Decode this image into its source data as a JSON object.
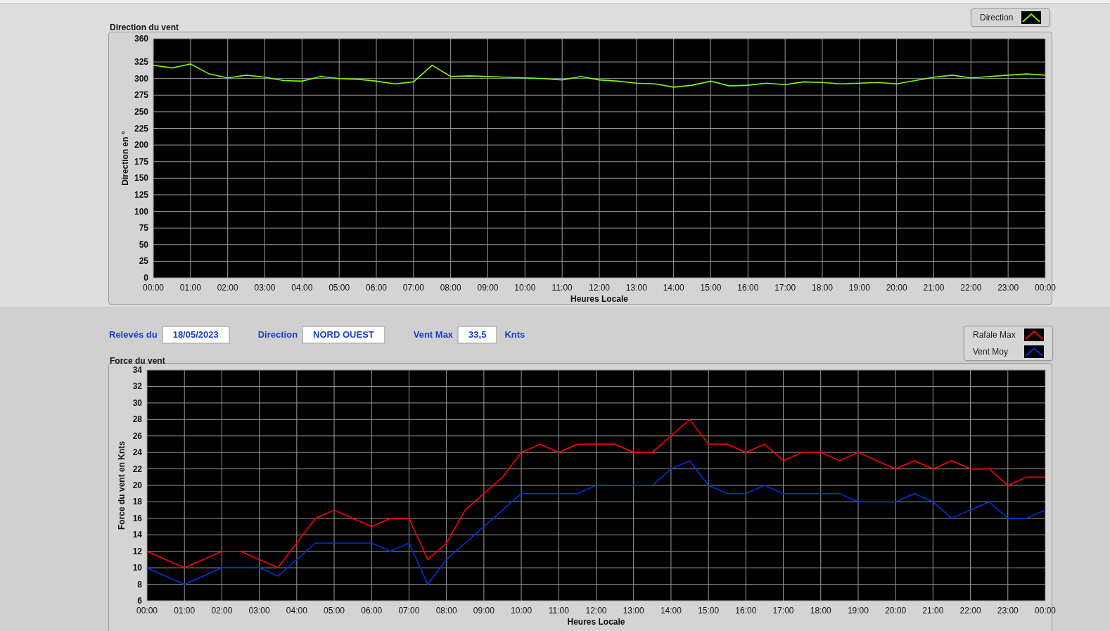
{
  "top_chart": {
    "chart_data": {
      "type": "line",
      "grid": true,
      "title": "Direction du vent",
      "xlabel": "Heures Locale",
      "ylabel": "Direction en °",
      "xlim": [
        0,
        24
      ],
      "ylim": [
        0,
        360
      ],
      "x": [
        0,
        0.5,
        1,
        1.5,
        2,
        2.5,
        3,
        3.5,
        4,
        4.5,
        5,
        5.5,
        6,
        6.5,
        7,
        7.5,
        8,
        8.5,
        9,
        9.5,
        10,
        10.5,
        11,
        11.5,
        12,
        12.5,
        13,
        13.5,
        14,
        14.5,
        15,
        15.5,
        16,
        16.5,
        17,
        17.5,
        18,
        18.5,
        19,
        19.5,
        20,
        20.5,
        21,
        21.5,
        22,
        22.5,
        23,
        23.5,
        24
      ],
      "series": [
        {
          "name": "Direction",
          "color": "#7cfc00",
          "values": [
            320,
            316,
            322,
            307,
            301,
            305,
            302,
            297,
            296,
            303,
            300,
            299,
            296,
            292,
            295,
            320,
            303,
            304,
            303,
            302,
            301,
            300,
            298,
            303,
            298,
            296,
            293,
            292,
            287,
            290,
            296,
            289,
            290,
            293,
            291,
            295,
            294,
            292,
            293,
            294,
            292,
            297,
            302,
            305,
            301,
            303,
            305,
            307,
            305
          ]
        }
      ],
      "xticks": [
        {
          "value": 0,
          "label": "00:00"
        },
        {
          "value": 1,
          "label": "01:00"
        },
        {
          "value": 2,
          "label": "02:00"
        },
        {
          "value": 3,
          "label": "03:00"
        },
        {
          "value": 4,
          "label": "04:00"
        },
        {
          "value": 5,
          "label": "05:00"
        },
        {
          "value": 6,
          "label": "06:00"
        },
        {
          "value": 7,
          "label": "07:00"
        },
        {
          "value": 8,
          "label": "08:00"
        },
        {
          "value": 9,
          "label": "09:00"
        },
        {
          "value": 10,
          "label": "10:00"
        },
        {
          "value": 11,
          "label": "11:00"
        },
        {
          "value": 12,
          "label": "12:00"
        },
        {
          "value": 13,
          "label": "13:00"
        },
        {
          "value": 14,
          "label": "14:00"
        },
        {
          "value": 15,
          "label": "15:00"
        },
        {
          "value": 16,
          "label": "16:00"
        },
        {
          "value": 17,
          "label": "17:00"
        },
        {
          "value": 18,
          "label": "18:00"
        },
        {
          "value": 19,
          "label": "19:00"
        },
        {
          "value": 20,
          "label": "20:00"
        },
        {
          "value": 21,
          "label": "21:00"
        },
        {
          "value": 22,
          "label": "22:00"
        },
        {
          "value": 23,
          "label": "23:00"
        },
        {
          "value": 24,
          "label": "00:00"
        }
      ],
      "yticks": [
        0,
        25,
        50,
        75,
        100,
        125,
        150,
        175,
        200,
        225,
        250,
        275,
        300,
        325,
        360
      ]
    }
  },
  "readings": [
    {
      "label": "Relevés du",
      "value": "18/05/2023"
    },
    {
      "label": "Direction",
      "value": "NORD OUEST"
    },
    {
      "label": "Vent Max",
      "value": "33,5",
      "unit": "Knts"
    }
  ],
  "bottom_chart": {
    "chart_data": {
      "type": "line",
      "grid": true,
      "title": "Force du vent",
      "xlabel": "Heures Locale",
      "ylabel": "Force du vent en Knts",
      "xlim": [
        0,
        24
      ],
      "ylim": [
        6,
        34
      ],
      "x": [
        0,
        0.5,
        1,
        1.5,
        2,
        2.5,
        3,
        3.5,
        4,
        4.5,
        5,
        5.5,
        6,
        6.5,
        7,
        7.5,
        8,
        8.5,
        9,
        9.5,
        10,
        10.5,
        11,
        11.5,
        12,
        12.5,
        13,
        13.5,
        14,
        14.5,
        15,
        15.5,
        16,
        16.5,
        17,
        17.5,
        18,
        18.5,
        19,
        19.5,
        20,
        20.5,
        21,
        21.5,
        22,
        22.5,
        23,
        23.5,
        24
      ],
      "series": [
        {
          "name": "Rafale Max",
          "color": "#ff0000",
          "values": [
            12,
            11,
            10,
            11,
            12,
            12,
            11,
            10,
            13,
            16,
            17,
            16,
            15,
            16,
            16,
            11,
            13,
            17,
            19,
            21,
            24,
            25,
            24,
            25,
            25,
            25,
            24,
            24,
            26,
            28,
            25,
            25,
            24,
            25,
            23,
            24,
            24,
            23,
            24,
            23,
            22,
            23,
            22,
            23,
            22,
            22,
            20,
            21,
            21
          ]
        },
        {
          "name": "Vent Moy",
          "color": "#0033dd",
          "values": [
            10,
            9,
            8,
            9,
            10,
            10,
            10,
            9,
            11,
            13,
            13,
            13,
            13,
            12,
            13,
            8,
            11,
            13,
            15,
            17,
            19,
            19,
            19,
            19,
            20,
            20,
            20,
            20,
            22,
            23,
            20,
            19,
            19,
            20,
            19,
            19,
            19,
            19,
            18,
            18,
            18,
            19,
            18,
            16,
            17,
            18,
            16,
            16,
            17
          ]
        }
      ],
      "xticks": [
        {
          "value": 0,
          "label": "00:00"
        },
        {
          "value": 1,
          "label": "01:00"
        },
        {
          "value": 2,
          "label": "02:00"
        },
        {
          "value": 3,
          "label": "03:00"
        },
        {
          "value": 4,
          "label": "04:00"
        },
        {
          "value": 5,
          "label": "05:00"
        },
        {
          "value": 6,
          "label": "06:00"
        },
        {
          "value": 7,
          "label": "07:00"
        },
        {
          "value": 8,
          "label": "08:00"
        },
        {
          "value": 9,
          "label": "09:00"
        },
        {
          "value": 10,
          "label": "10:00"
        },
        {
          "value": 11,
          "label": "11:00"
        },
        {
          "value": 12,
          "label": "12:00"
        },
        {
          "value": 13,
          "label": "13:00"
        },
        {
          "value": 14,
          "label": "14:00"
        },
        {
          "value": 15,
          "label": "15:00"
        },
        {
          "value": 16,
          "label": "16:00"
        },
        {
          "value": 17,
          "label": "17:00"
        },
        {
          "value": 18,
          "label": "18:00"
        },
        {
          "value": 19,
          "label": "19:00"
        },
        {
          "value": 20,
          "label": "20:00"
        },
        {
          "value": 21,
          "label": "21:00"
        },
        {
          "value": 22,
          "label": "22:00"
        },
        {
          "value": 23,
          "label": "23:00"
        },
        {
          "value": 24,
          "label": "00:00"
        }
      ],
      "yticks": [
        6,
        8,
        10,
        12,
        14,
        16,
        18,
        20,
        22,
        24,
        26,
        28,
        30,
        32,
        34
      ]
    }
  }
}
